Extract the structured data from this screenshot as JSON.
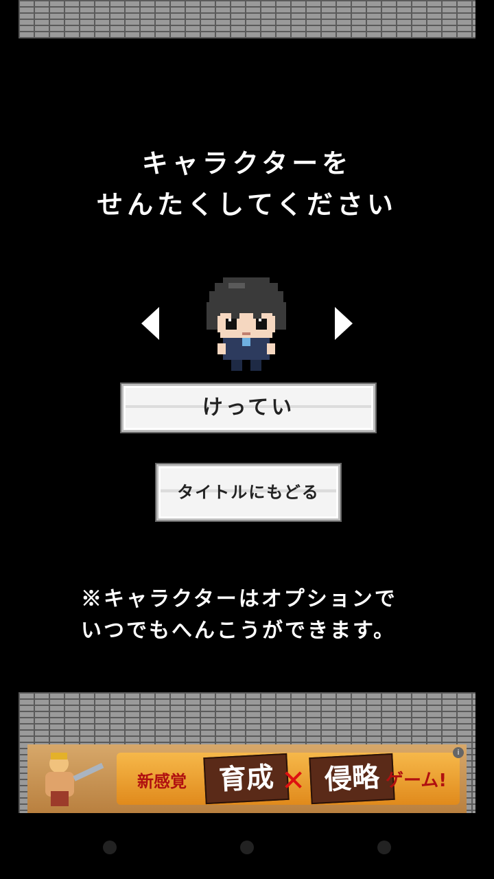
{
  "title": {
    "line1": "キャラクターを",
    "line2": "せんたくしてください"
  },
  "selector": {
    "prev_icon": "triangle-left-icon",
    "next_icon": "triangle-right-icon"
  },
  "buttons": {
    "decide": "けってい",
    "back_to_title": "タイトルにもどる"
  },
  "note": {
    "line1": "※キャラクターはオプションで",
    "line2": "いつでもへんこうができます。"
  },
  "ad": {
    "text1": "新感覚",
    "box1": "育成",
    "cross": "✕",
    "box2": "侵略",
    "text2": "ゲーム!",
    "info_icon": "i"
  },
  "colors": {
    "background": "#000000",
    "text": "#ffffff",
    "button_bg": "#f4f4f4"
  }
}
